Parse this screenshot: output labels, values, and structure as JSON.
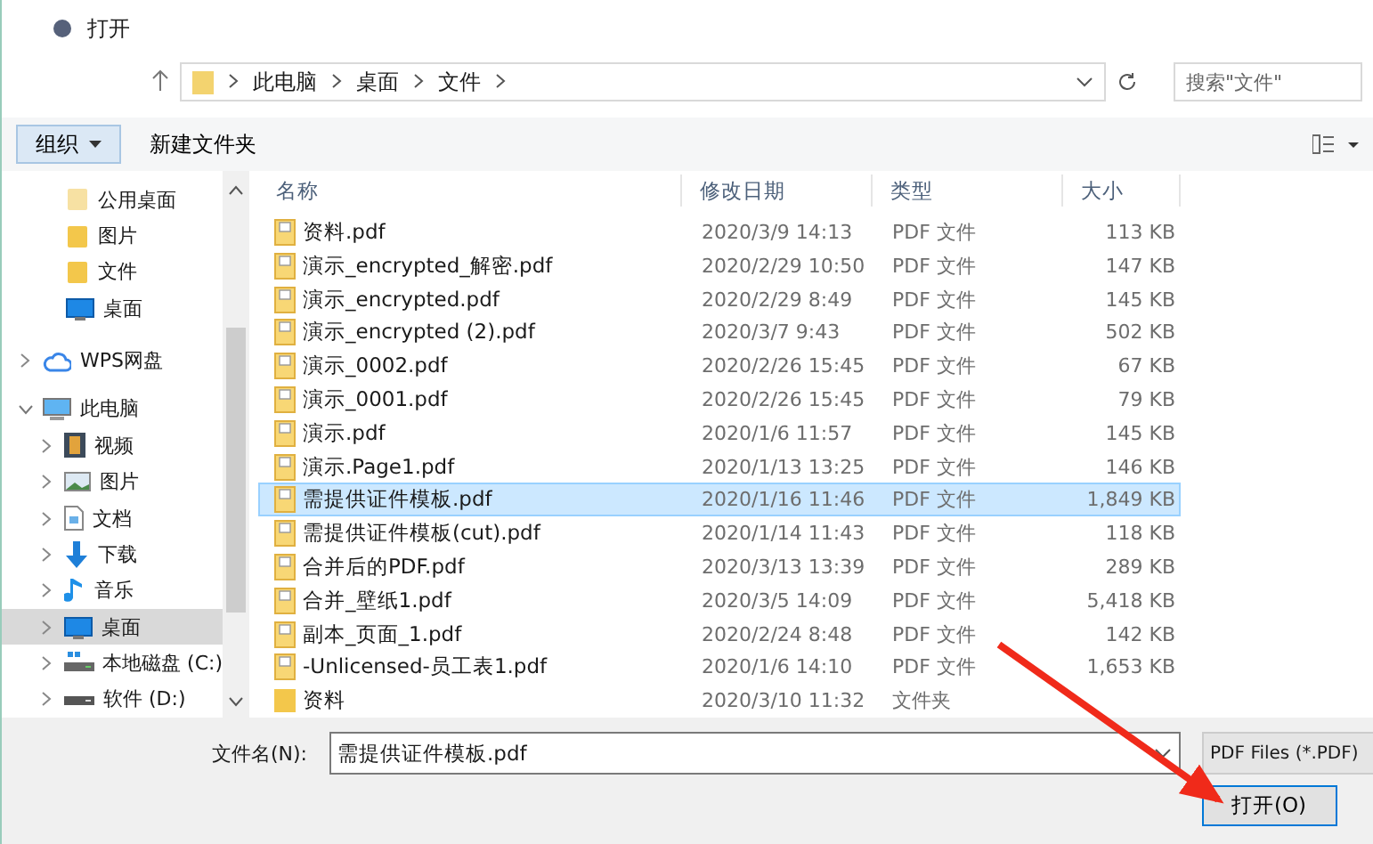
{
  "window": {
    "title": "打开"
  },
  "address_bar": {
    "breadcrumbs": [
      "此电脑",
      "桌面",
      "文件"
    ],
    "search": {
      "placeholder": "搜索\"文件\""
    }
  },
  "toolbar": {
    "organize": "组织",
    "new_folder": "新建文件夹"
  },
  "navigation": {
    "pinned": [
      {
        "label": "公用桌面",
        "kind": "folder-faded",
        "selected": false
      },
      {
        "label": "图片",
        "kind": "folder",
        "selected": false
      },
      {
        "label": "文件",
        "kind": "folder",
        "selected": false
      },
      {
        "label": "桌面",
        "kind": "desktop",
        "selected": false
      }
    ],
    "tree": [
      {
        "label": "WPS网盘",
        "kind": "cloud",
        "expanded": false,
        "selected": false
      },
      {
        "label": "此电脑",
        "kind": "computer",
        "expanded": true,
        "selected": false,
        "children": [
          {
            "label": "视频",
            "kind": "video",
            "expanded": false,
            "selected": false
          },
          {
            "label": "图片",
            "kind": "pictures",
            "expanded": false,
            "selected": false
          },
          {
            "label": "文档",
            "kind": "documents",
            "expanded": false,
            "selected": false
          },
          {
            "label": "下载",
            "kind": "download",
            "expanded": false,
            "selected": false
          },
          {
            "label": "音乐",
            "kind": "music",
            "expanded": false,
            "selected": false
          },
          {
            "label": "桌面",
            "kind": "desktop",
            "expanded": false,
            "selected": true
          },
          {
            "label": "本地磁盘 (C:)",
            "kind": "system-drive",
            "expanded": false,
            "selected": false
          },
          {
            "label": "软件 (D:)",
            "kind": "drive",
            "expanded": false,
            "selected": false
          }
        ]
      }
    ]
  },
  "table": {
    "columns": [
      "名称",
      "修改日期",
      "类型",
      "大小"
    ],
    "rows": [
      {
        "kind": "pdf",
        "name": "资料.pdf",
        "date": "2020/3/9 14:13",
        "type": "PDF 文件",
        "size": "113 KB",
        "selected": false
      },
      {
        "kind": "pdf",
        "name": "演示_encrypted_解密.pdf",
        "date": "2020/2/29 10:50",
        "type": "PDF 文件",
        "size": "147 KB",
        "selected": false
      },
      {
        "kind": "pdf",
        "name": "演示_encrypted.pdf",
        "date": "2020/2/29 8:49",
        "type": "PDF 文件",
        "size": "145 KB",
        "selected": false
      },
      {
        "kind": "pdf",
        "name": "演示_encrypted (2).pdf",
        "date": "2020/3/7 9:43",
        "type": "PDF 文件",
        "size": "502 KB",
        "selected": false
      },
      {
        "kind": "pdf",
        "name": "演示_0002.pdf",
        "date": "2020/2/26 15:45",
        "type": "PDF 文件",
        "size": "67 KB",
        "selected": false
      },
      {
        "kind": "pdf",
        "name": "演示_0001.pdf",
        "date": "2020/2/26 15:45",
        "type": "PDF 文件",
        "size": "79 KB",
        "selected": false
      },
      {
        "kind": "pdf",
        "name": "演示.pdf",
        "date": "2020/1/6 11:57",
        "type": "PDF 文件",
        "size": "145 KB",
        "selected": false
      },
      {
        "kind": "pdf",
        "name": "演示.Page1.pdf",
        "date": "2020/1/13 13:25",
        "type": "PDF 文件",
        "size": "146 KB",
        "selected": false
      },
      {
        "kind": "pdf",
        "name": "需提供证件模板.pdf",
        "date": "2020/1/16 11:46",
        "type": "PDF 文件",
        "size": "1,849 KB",
        "selected": true
      },
      {
        "kind": "pdf",
        "name": "需提供证件模板(cut).pdf",
        "date": "2020/1/14 11:43",
        "type": "PDF 文件",
        "size": "118 KB",
        "selected": false
      },
      {
        "kind": "pdf",
        "name": "合并后的PDF.pdf",
        "date": "2020/3/13 13:39",
        "type": "PDF 文件",
        "size": "289 KB",
        "selected": false
      },
      {
        "kind": "pdf",
        "name": "合并_壁纸1.pdf",
        "date": "2020/3/5 14:09",
        "type": "PDF 文件",
        "size": "5,418 KB",
        "selected": false
      },
      {
        "kind": "pdf",
        "name": "副本_页面_1.pdf",
        "date": "2020/2/24 8:48",
        "type": "PDF 文件",
        "size": "142 KB",
        "selected": false
      },
      {
        "kind": "pdf",
        "name": "-Unlicensed-员工表1.pdf",
        "date": "2020/1/6 14:10",
        "type": "PDF 文件",
        "size": "1,653 KB",
        "selected": false
      },
      {
        "kind": "folder",
        "name": "资料",
        "date": "2020/3/10 11:32",
        "type": "文件夹",
        "size": "",
        "selected": false
      }
    ]
  },
  "footer": {
    "filename_label": "文件名(N):",
    "filename_value": "需提供证件模板.pdf",
    "filter": "PDF Files (*.PDF)",
    "open_button": "打开(O)"
  }
}
